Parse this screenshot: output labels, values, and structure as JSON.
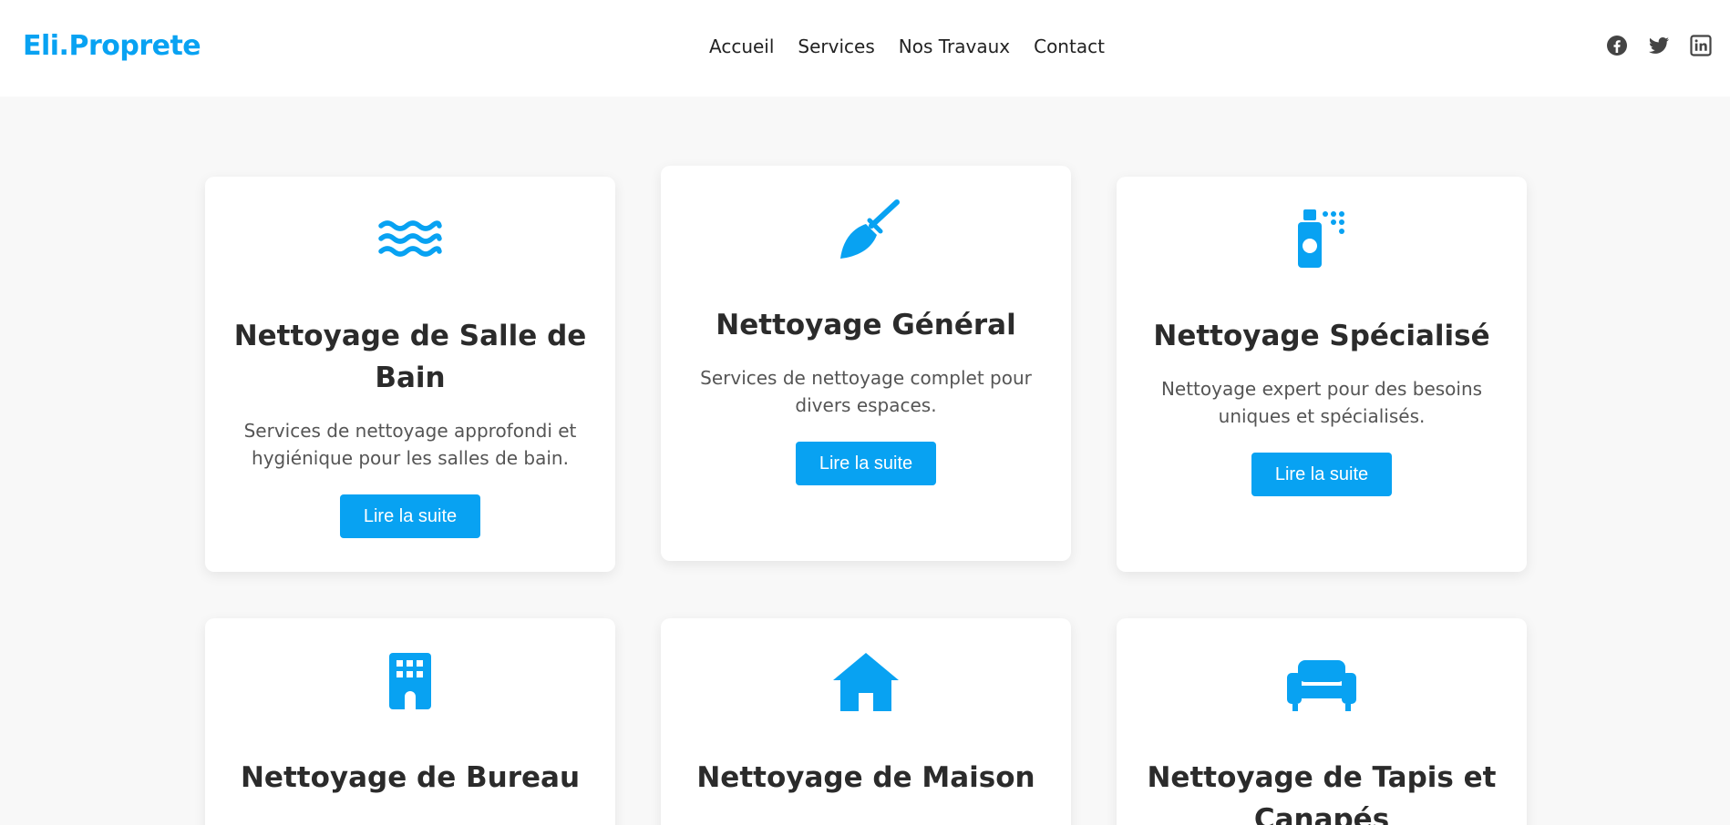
{
  "header": {
    "logo": "Eli.Proprete",
    "nav": [
      "Accueil",
      "Services",
      "Nos Travaux",
      "Contact"
    ],
    "social_icons": [
      "facebook-icon",
      "twitter-icon",
      "linkedin-icon"
    ]
  },
  "colors": {
    "accent": "#08a2f2",
    "background": "#f8f8f8",
    "card": "#ffffff",
    "heading": "#2b2b2b",
    "text": "#555555"
  },
  "services": [
    {
      "icon": "water-waves-icon",
      "title": "Nettoyage de Salle de Bain",
      "description": "Services de nettoyage approfondi et hygiénique pour les salles de bain.",
      "button": "Lire la suite"
    },
    {
      "icon": "broom-icon",
      "title": "Nettoyage Général",
      "description": "Services de nettoyage complet pour divers espaces.",
      "button": "Lire la suite"
    },
    {
      "icon": "spray-bottle-icon",
      "title": "Nettoyage Spécialisé",
      "description": "Nettoyage expert pour des besoins uniques et spécialisés.",
      "button": "Lire la suite"
    },
    {
      "icon": "building-icon",
      "title": "Nettoyage de Bureau",
      "description": "",
      "button": ""
    },
    {
      "icon": "house-icon",
      "title": "Nettoyage de Maison",
      "description": "",
      "button": ""
    },
    {
      "icon": "couch-icon",
      "title": "Nettoyage de Tapis et Canapés",
      "description": "",
      "button": ""
    }
  ]
}
